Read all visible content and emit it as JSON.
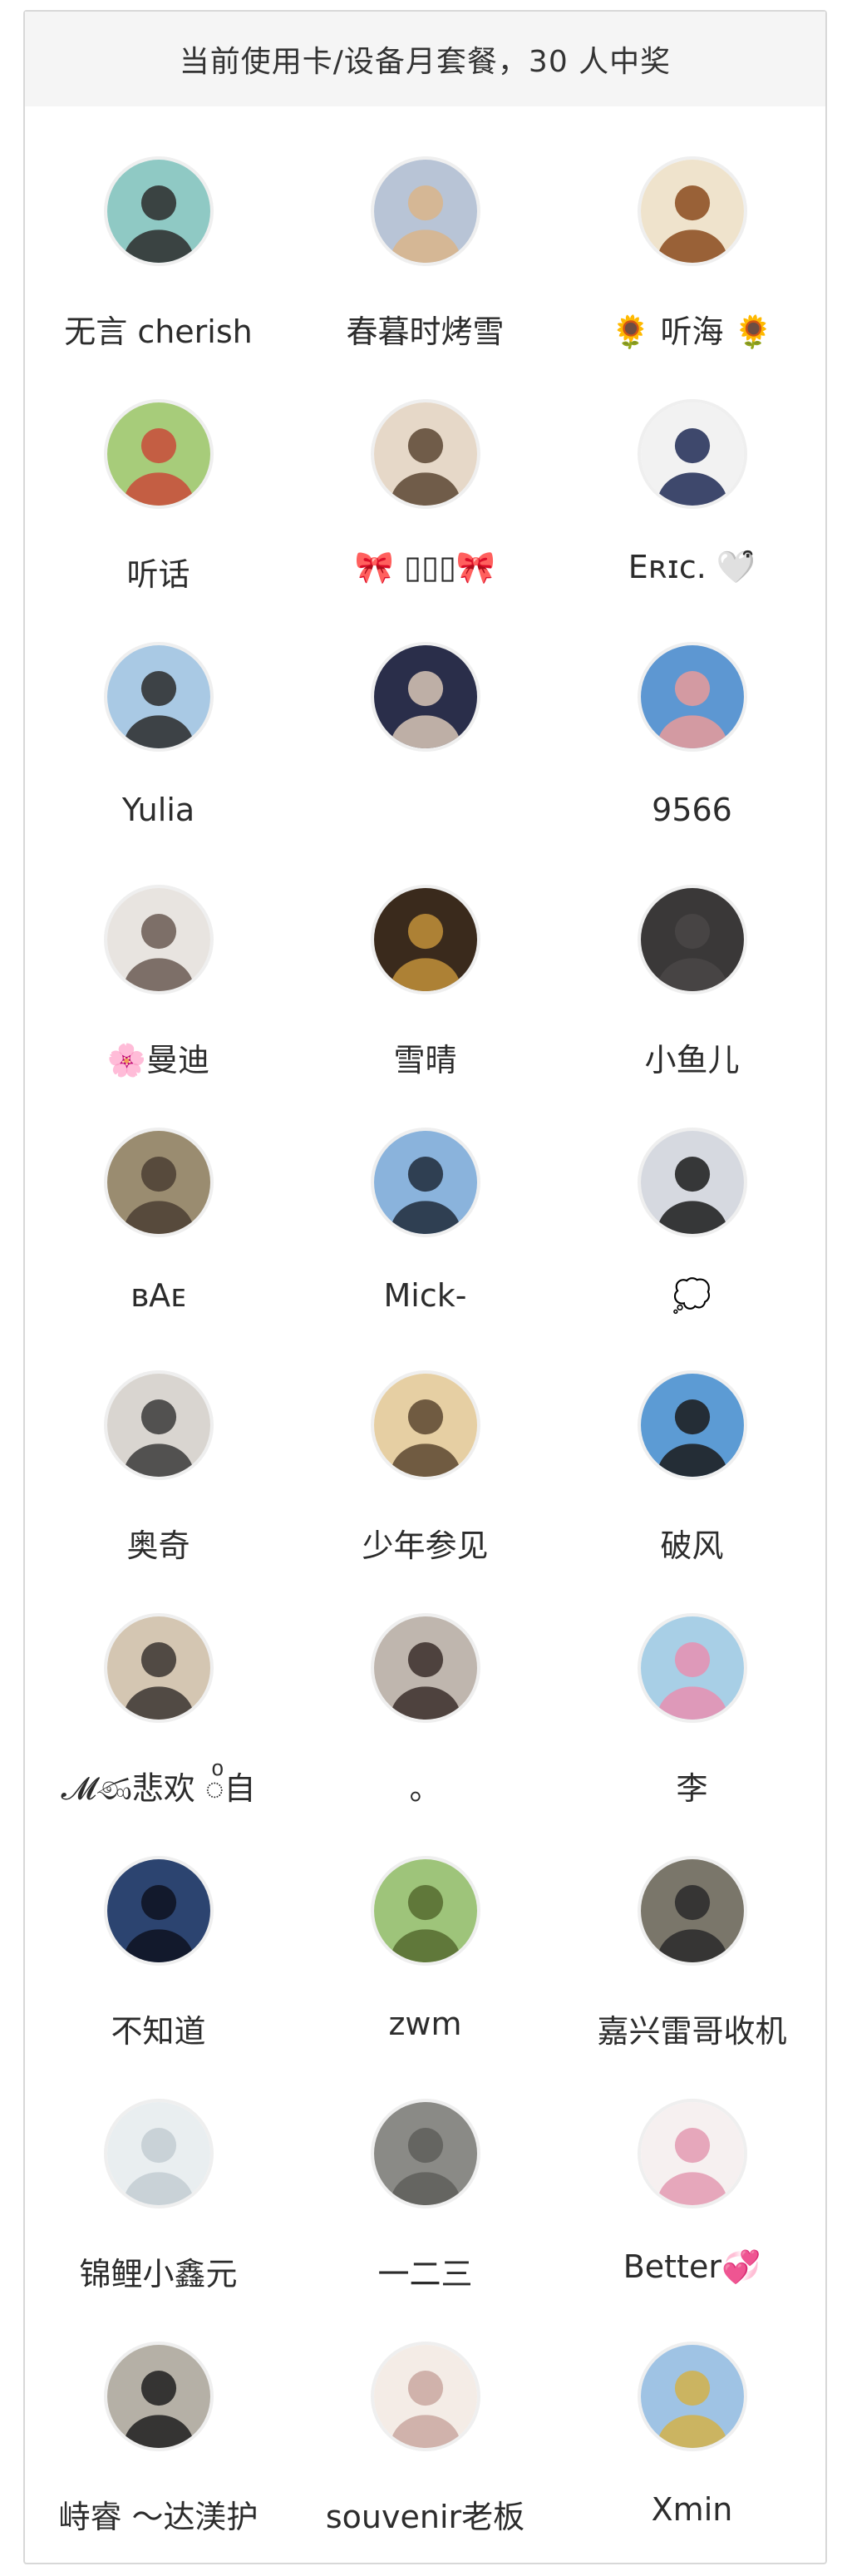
{
  "header": {
    "title": "当前使用卡/设备月套餐，30 人中奖"
  },
  "winners": [
    {
      "name": "无言 cherish",
      "avatar": "portrait-icon",
      "bg": "#8fc9c4",
      "fg": "#2b2b2b"
    },
    {
      "name": "春暮时烤雪",
      "avatar": "dog-icon",
      "bg": "#b8c4d6",
      "fg": "#d9b58a"
    },
    {
      "name": "🌻 听海 🌻",
      "avatar": "calligraphy-icon",
      "bg": "#efe3cc",
      "fg": "#8a4a1c"
    },
    {
      "name": "听话",
      "avatar": "picnic-icon",
      "bg": "#a7cc7a",
      "fg": "#c94a3a"
    },
    {
      "name": "🎀 ▯▯▯🎀",
      "avatar": "child-icon",
      "bg": "#e6d8c8",
      "fg": "#5a4632"
    },
    {
      "name": "Eʀɪᴄ. 🤍͒",
      "avatar": "cat-icon",
      "bg": "#f2f2f2",
      "fg": "#1e2a55"
    },
    {
      "name": "Yulia",
      "avatar": "beach-icon",
      "bg": "#a9c9e4",
      "fg": "#2a2a2a"
    },
    {
      "name": "",
      "avatar": "anime-icon",
      "bg": "#2a2e4a",
      "fg": "#d8c6b6"
    },
    {
      "name": "9566",
      "avatar": "pig-icon",
      "bg": "#5d97d2",
      "fg": "#e79a9a"
    },
    {
      "name": "🌸曼迪",
      "avatar": "selfie-icon",
      "bg": "#e8e4e0",
      "fg": "#6a5a52"
    },
    {
      "name": "雪晴",
      "avatar": "lion-icon",
      "bg": "#3a2a1c",
      "fg": "#c2913a"
    },
    {
      "name": "小鱼儿",
      "avatar": "dark-icon",
      "bg": "#3a3838",
      "fg": "#4a4646"
    },
    {
      "name": "ʙAᴇ",
      "avatar": "mask-icon",
      "bg": "#9a8c70",
      "fg": "#4b3e32"
    },
    {
      "name": "Mick-",
      "avatar": "snow-icon",
      "bg": "#8ab3dc",
      "fg": "#1e2a3a"
    },
    {
      "name": "💭",
      "avatar": "silhouette-icon",
      "bg": "#d6d9e0",
      "fg": "#1a1a1a"
    },
    {
      "name": "奥奇",
      "avatar": "man-icon",
      "bg": "#d9d5d0",
      "fg": "#3a3a3a"
    },
    {
      "name": "少年参见",
      "avatar": "sketch-icon",
      "bg": "#e6cfa3",
      "fg": "#5a4630"
    },
    {
      "name": "破风",
      "avatar": "sunset-icon",
      "bg": "#5c9bd4",
      "fg": "#1a1a1a"
    },
    {
      "name": "𝓜ණ悲欢 ◌ͦ自",
      "avatar": "man-icon",
      "bg": "#d4c6b2",
      "fg": "#3a3430"
    },
    {
      "name": "。",
      "avatar": "woman-icon",
      "bg": "#bfb6ae",
      "fg": "#3a2e2a"
    },
    {
      "name": "李",
      "avatar": "flower-icon",
      "bg": "#a8cfe6",
      "fg": "#e78fb0"
    },
    {
      "name": "不知道",
      "avatar": "anime-boy-icon",
      "bg": "#2c4470",
      "fg": "#0e1220"
    },
    {
      "name": "zwm",
      "avatar": "meadow-icon",
      "bg": "#9ec47a",
      "fg": "#556b2f"
    },
    {
      "name": "嘉兴雷哥收机",
      "avatar": "man-icon",
      "bg": "#7a766a",
      "fg": "#2a2a2a"
    },
    {
      "name": "锦鲤小鑫元",
      "avatar": "mountain-icon",
      "bg": "#e9eef0",
      "fg": "#c3cdd2"
    },
    {
      "name": "一二三",
      "avatar": "stone-icon",
      "bg": "#8a8a86",
      "fg": "#5e5e5a"
    },
    {
      "name": "Better💞",
      "avatar": "doll-icon",
      "bg": "#f6f0f0",
      "fg": "#e39ab2"
    },
    {
      "name": "峙睿 ～达渼护",
      "avatar": "man-icon",
      "bg": "#b5b0a6",
      "fg": "#1e1e1e"
    },
    {
      "name": "souvenir老板",
      "avatar": "sheep-icon",
      "bg": "#f4ece6",
      "fg": "#c9a8a0"
    },
    {
      "name": "Xmin",
      "avatar": "field-icon",
      "bg": "#9fc3e4",
      "fg": "#d2b14a"
    }
  ]
}
